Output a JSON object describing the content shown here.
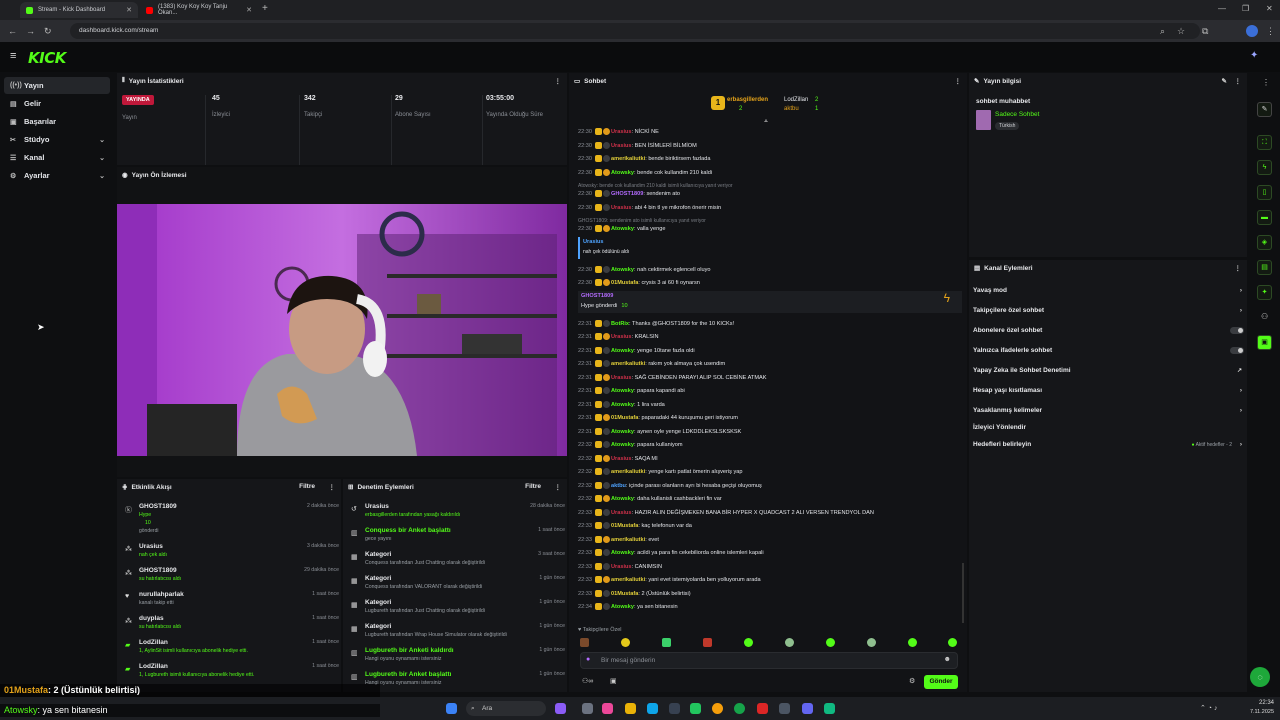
{
  "browser": {
    "tabs": [
      {
        "label": "Stream - Kick Dashboard",
        "active": true
      },
      {
        "label": "(1383) Koy Koy Koy Tanju Okan...",
        "active": false
      }
    ],
    "url": "dashboard.kick.com/stream"
  },
  "brand": {
    "logo": "KICK",
    "accent": "#53fc18"
  },
  "sidebar": {
    "items": [
      {
        "label": "Yayın",
        "icon": "signal-icon",
        "active": true,
        "expandable": false
      },
      {
        "label": "Gelir",
        "icon": "wallet-icon",
        "active": false,
        "expandable": false
      },
      {
        "label": "Başarılar",
        "icon": "trophy-icon",
        "active": false,
        "expandable": false
      },
      {
        "label": "Stüdyo",
        "icon": "studio-icon",
        "active": false,
        "expandable": true
      },
      {
        "label": "Kanal",
        "icon": "channel-icon",
        "active": false,
        "expandable": true
      },
      {
        "label": "Ayarlar",
        "icon": "gear-icon",
        "active": false,
        "expandable": true
      }
    ]
  },
  "stats": {
    "title": "Yayın İstatistikleri",
    "items": [
      {
        "value": "YAYINDA",
        "label": "Yayın"
      },
      {
        "value": "45",
        "label": "İzleyici"
      },
      {
        "value": "342",
        "label": "Takipçi"
      },
      {
        "value": "29",
        "label": "Abone Sayısı"
      },
      {
        "value": "03:55:00",
        "label": "Yayında Olduğu Süre"
      }
    ]
  },
  "preview": {
    "title": "Yayın Ön İzlemesi"
  },
  "activity": {
    "title": "Etkinlik Akışı",
    "filter": "Filtre",
    "items": [
      {
        "name": "GHOST1809",
        "line1": "Hype",
        "line2": "10",
        "line3": "gönderdi",
        "time": "2 dakika önce"
      },
      {
        "name": "Urasius",
        "line1": "nah çek aldı",
        "time": "3 dakika önce"
      },
      {
        "name": "GHOST1809",
        "line1": "su hatırlatıcısı aldı",
        "time": "29 dakika önce"
      },
      {
        "name": "nurullahparlak",
        "line1": "kanalı takip etti",
        "time": "1 saat önce"
      },
      {
        "name": "duyplas",
        "line1": "su hatırlatıcısı aldı",
        "time": "1 saat önce"
      },
      {
        "name": "LodZillan",
        "line1": "1, AylinSit isimli kullanıcıya abonelik hediye etti.",
        "time": "1 saat önce"
      },
      {
        "name": "LodZillan",
        "line1": "1, Lugbureth isimli kullanıcıya abonelik hediye etti.",
        "time": "1 saat önce"
      }
    ]
  },
  "moderation": {
    "title": "Denetim Eylemleri",
    "filter": "Filtre",
    "items": [
      {
        "name": "Urasius",
        "line1": "erbasgillerden tarafından yasağı kaldırıldı",
        "line2": "",
        "time": "28 dakika önce"
      },
      {
        "name": "Conquess bir Anket başlattı",
        "line1": "gece yayını",
        "line2": "",
        "time": "1 saat önce"
      },
      {
        "name": "Kategori",
        "line1": "Conquess tarafından Just Chatting olarak değiştirildi",
        "line2": "",
        "time": "3 saat önce"
      },
      {
        "name": "Kategori",
        "line1": "Conquess tarafından VALORANT olarak değiştirildi",
        "line2": "",
        "time": "1 gün önce"
      },
      {
        "name": "Kategori",
        "line1": "Lugbureth tarafından Just Chatting olarak değiştirildi",
        "line2": "",
        "time": "1 gün önce"
      },
      {
        "name": "Kategori",
        "line1": "Lugbureth tarafından Wrap House Simulator olarak değiştirildi",
        "line2": "",
        "time": "1 gün önce"
      },
      {
        "name": "Lugbureth bir Anketi kaldırdı",
        "line1": "Hangi oyunu oynamamı istersiniz",
        "line2": "",
        "time": "1 gün önce"
      },
      {
        "name": "Lugbureth bir Anket başlattı",
        "line1": "Hangi oyunu oynamamı istersiniz",
        "line2": "",
        "time": "1 gün önce"
      }
    ]
  },
  "chat": {
    "title": "Sohbet",
    "top_users": [
      {
        "name": "erbasgillerden",
        "count": "2"
      },
      {
        "name": "LodZillan",
        "count": "2"
      },
      {
        "name": "aktbu",
        "count": "1"
      }
    ],
    "messages": [
      {
        "time": "22:30",
        "user": "Urasius",
        "color": "#d0314a",
        "text": "NİCKİ NE"
      },
      {
        "time": "22:30",
        "user": "Urasius",
        "color": "#d0314a",
        "text": "BEN İSİMLERİ BİLMİOM"
      },
      {
        "time": "22:30",
        "user": "amerikaliutki",
        "color": "#e3d03a",
        "text": "bende biriktirsem fazlada"
      },
      {
        "time": "22:30",
        "user": "Atowsky",
        "color": "#53fc18",
        "text": "bende cok kullandim 210 kaldi"
      },
      {
        "time": "22:30",
        "user": "GHOST1809",
        "color": "#b36bff",
        "text": "sendenim ato",
        "reply": "Atowsky: bende cok kullandim 210 kaldi isimli kullanıcıya yanıt veriyor"
      },
      {
        "time": "22:30",
        "user": "Urasius",
        "color": "#d0314a",
        "text": "abi 4 bin tl ye mikrofon önerir misin"
      },
      {
        "time": "22:30",
        "user": "Atowsky",
        "color": "#53fc18",
        "text": "valla yenge",
        "reply": "GHOST1809: sendenim ato isimli kullanıcıya yanıt veriyor"
      },
      {
        "time": "",
        "user": "Urasius",
        "color": "#4ea3ff",
        "text": "nah çek ödülünü aldı"
      },
      {
        "time": "22:30",
        "user": "Atowsky",
        "color": "#53fc18",
        "text": "nah cektirmek eglencell oluyo"
      },
      {
        "time": "22:30",
        "user": "01Mustafa",
        "color": "#e3d03a",
        "text": "crysis 3 ai 60 fi oynarsn"
      },
      {
        "time": "",
        "user": "GHOST1809",
        "color": "#b36bff",
        "text": "Hype gönderdi",
        "amount": "10"
      },
      {
        "time": "22:31",
        "user": "BotRix",
        "color": "#53fc18",
        "text": "Thanks @GHOST1809 for the 10 KICKs!"
      },
      {
        "time": "22:31",
        "user": "Urasius",
        "color": "#d0314a",
        "text": "KRALSIN"
      },
      {
        "time": "22:31",
        "user": "Atowsky",
        "color": "#53fc18",
        "text": "yenge 10tane fazla oldi"
      },
      {
        "time": "22:31",
        "user": "amerikaliutki",
        "color": "#e3d03a",
        "text": "rakım yok almaya çok usendim"
      },
      {
        "time": "22:31",
        "user": "Urasius",
        "color": "#d0314a",
        "text": "SAĞ CEBİNDEN PARAYI ALIP SOL CEBİNE ATMAK"
      },
      {
        "time": "22:31",
        "user": "Atowsky",
        "color": "#53fc18",
        "text": "papara kapandi abi"
      },
      {
        "time": "22:31",
        "user": "Atowsky",
        "color": "#53fc18",
        "text": "1 lira varda"
      },
      {
        "time": "22:31",
        "user": "01Mustafa",
        "color": "#e3d03a",
        "text": "paparadaki 44 kuruşumu geri istiyorum"
      },
      {
        "time": "22:31",
        "user": "Atowsky",
        "color": "#53fc18",
        "text": "aynen oyle yenge LDKDDLEKSLSKSKSK"
      },
      {
        "time": "22:32",
        "user": "Atowsky",
        "color": "#53fc18",
        "text": "papara kullaniyom"
      },
      {
        "time": "22:32",
        "user": "Urasius",
        "color": "#d0314a",
        "text": "SAQA MI"
      },
      {
        "time": "22:32",
        "user": "amerikaliutki",
        "color": "#e3d03a",
        "text": "yenge kartı patlat ömerin alışveriş yap"
      },
      {
        "time": "22:32",
        "user": "aktbu",
        "color": "#4ea3ff",
        "text": "içinde parası olanların ayrı bi hesaba geçişi oluyomuş"
      },
      {
        "time": "22:32",
        "user": "Atowsky",
        "color": "#53fc18",
        "text": "daha kullanisli cashbackleri fin var"
      },
      {
        "time": "22:33",
        "user": "Urasius",
        "color": "#d0314a",
        "text": "HAZIR ALIN DEĞİŞMEKEN BANA BİR HYPER X QUADCAST 2 ALI VERSEN TRENDYOL DAN"
      },
      {
        "time": "22:33",
        "user": "01Mustafa",
        "color": "#e3d03a",
        "text": "kaç telefonun var da"
      },
      {
        "time": "22:33",
        "user": "amerikaliutki",
        "color": "#e3d03a",
        "text": "evet"
      },
      {
        "time": "22:33",
        "user": "Atowsky",
        "color": "#53fc18",
        "text": "acildi ya para fin cekebiliorda online islemleri kapali"
      },
      {
        "time": "22:33",
        "user": "Urasius",
        "color": "#d0314a",
        "text": "CANIMSIN"
      },
      {
        "time": "22:33",
        "user": "amerikaliutki",
        "color": "#e3d03a",
        "text": "yani evet istemiyolarda ben yolluyorum arada"
      },
      {
        "time": "22:33",
        "user": "01Mustafa",
        "color": "#e3d03a",
        "text": "2 (Üstünlük belirtisi)"
      },
      {
        "time": "22:34",
        "user": "Atowsky",
        "color": "#53fc18",
        "text": "ya sen bitanesin"
      }
    ],
    "mode": "Takipçilere Özel",
    "input_placeholder": "Bir mesaj gönderin",
    "send_label": "Gönder"
  },
  "stream_info": {
    "title": "Yayın bilgisi",
    "stream_title": "sohbet muhabbet",
    "category": "Sadece Sohbet",
    "language": "Türkish"
  },
  "channel_actions": {
    "title": "Kanal Eylemleri",
    "items": [
      {
        "label": "Yavaş mod",
        "control": "arrow"
      },
      {
        "label": "Takipçilere özel sohbet",
        "control": "arrow"
      },
      {
        "label": "Abonelere özel sohbet",
        "control": "toggle"
      },
      {
        "label": "Yalnızca ifadelerle sohbet",
        "control": "toggle"
      },
      {
        "label": "Yapay Zeka ile Sohbet Denetimi",
        "control": "external"
      },
      {
        "label": "Hesap yaşı kısıtlaması",
        "control": "arrow"
      },
      {
        "label": "Yasaklanmış kelimeler",
        "control": "arrow"
      },
      {
        "label": "İzleyici Yönlendir",
        "control": "none"
      },
      {
        "label": "Hedefleri belirleyin",
        "control": "arrow",
        "status": "Aktif hedefler - 2"
      }
    ]
  },
  "overlay": {
    "line1_user": "01Mustafa",
    "line1_text": ": 2 (Üstünlük belirtisi)",
    "line2_user": "Atowsky",
    "line2_text": ": ya sen bitanesin"
  },
  "taskbar": {
    "search": "Ara",
    "time": "22:34",
    "date": "7.11.2025"
  }
}
